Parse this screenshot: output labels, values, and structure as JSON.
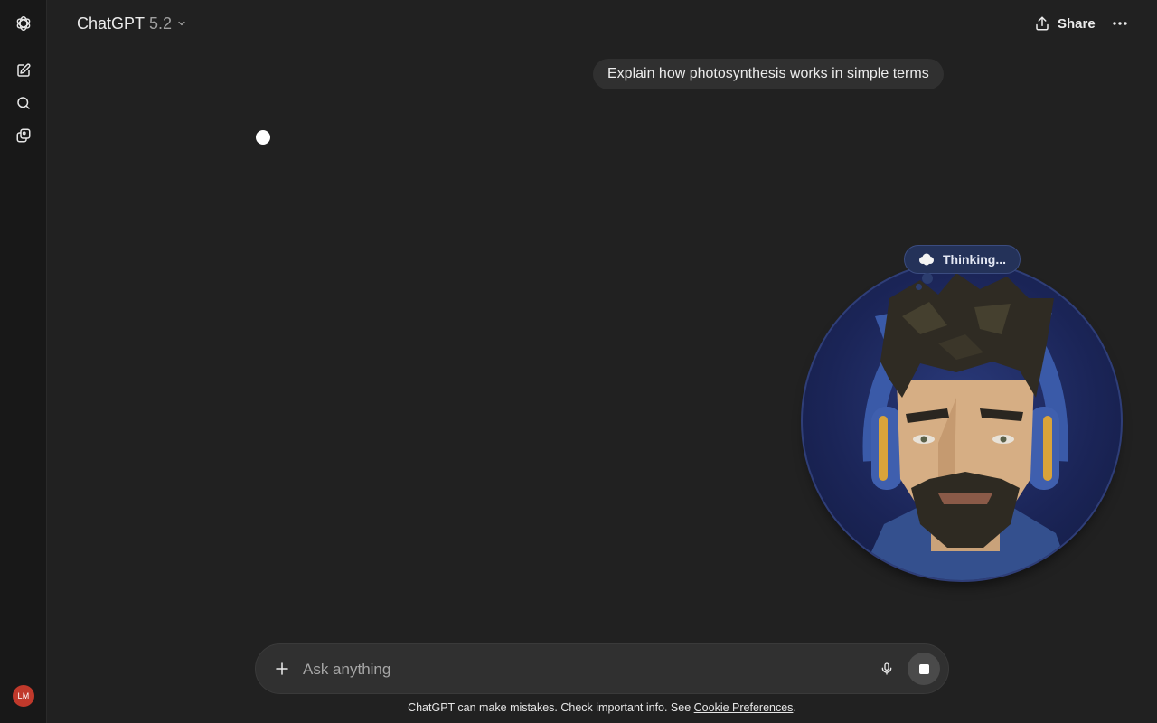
{
  "header": {
    "model_name": "ChatGPT",
    "model_version": "5.2",
    "share_label": "Share"
  },
  "conversation": {
    "user_message": "Explain how photosynthesis works in simple terms"
  },
  "avatar_widget": {
    "status": "Thinking..."
  },
  "composer": {
    "placeholder": "Ask anything"
  },
  "footer": {
    "disclaimer_text": "ChatGPT can make mistakes. Check important info. See ",
    "cookie_link": "Cookie Preferences",
    "disclaimer_end": "."
  },
  "user": {
    "initials": "LM"
  },
  "icons": {
    "logo": "openai-logo-icon",
    "new_chat": "new-chat-icon",
    "search": "search-icon",
    "library": "library-icon",
    "share": "share-icon",
    "more": "more-horizontal-icon",
    "plus": "plus-icon",
    "mic": "microphone-icon",
    "stop": "stop-icon"
  },
  "colors": {
    "background": "#212121",
    "rail": "#181818",
    "bubble": "#303030",
    "avatar_badge": "#c0392b",
    "avatar_bg": "#1b2558"
  }
}
